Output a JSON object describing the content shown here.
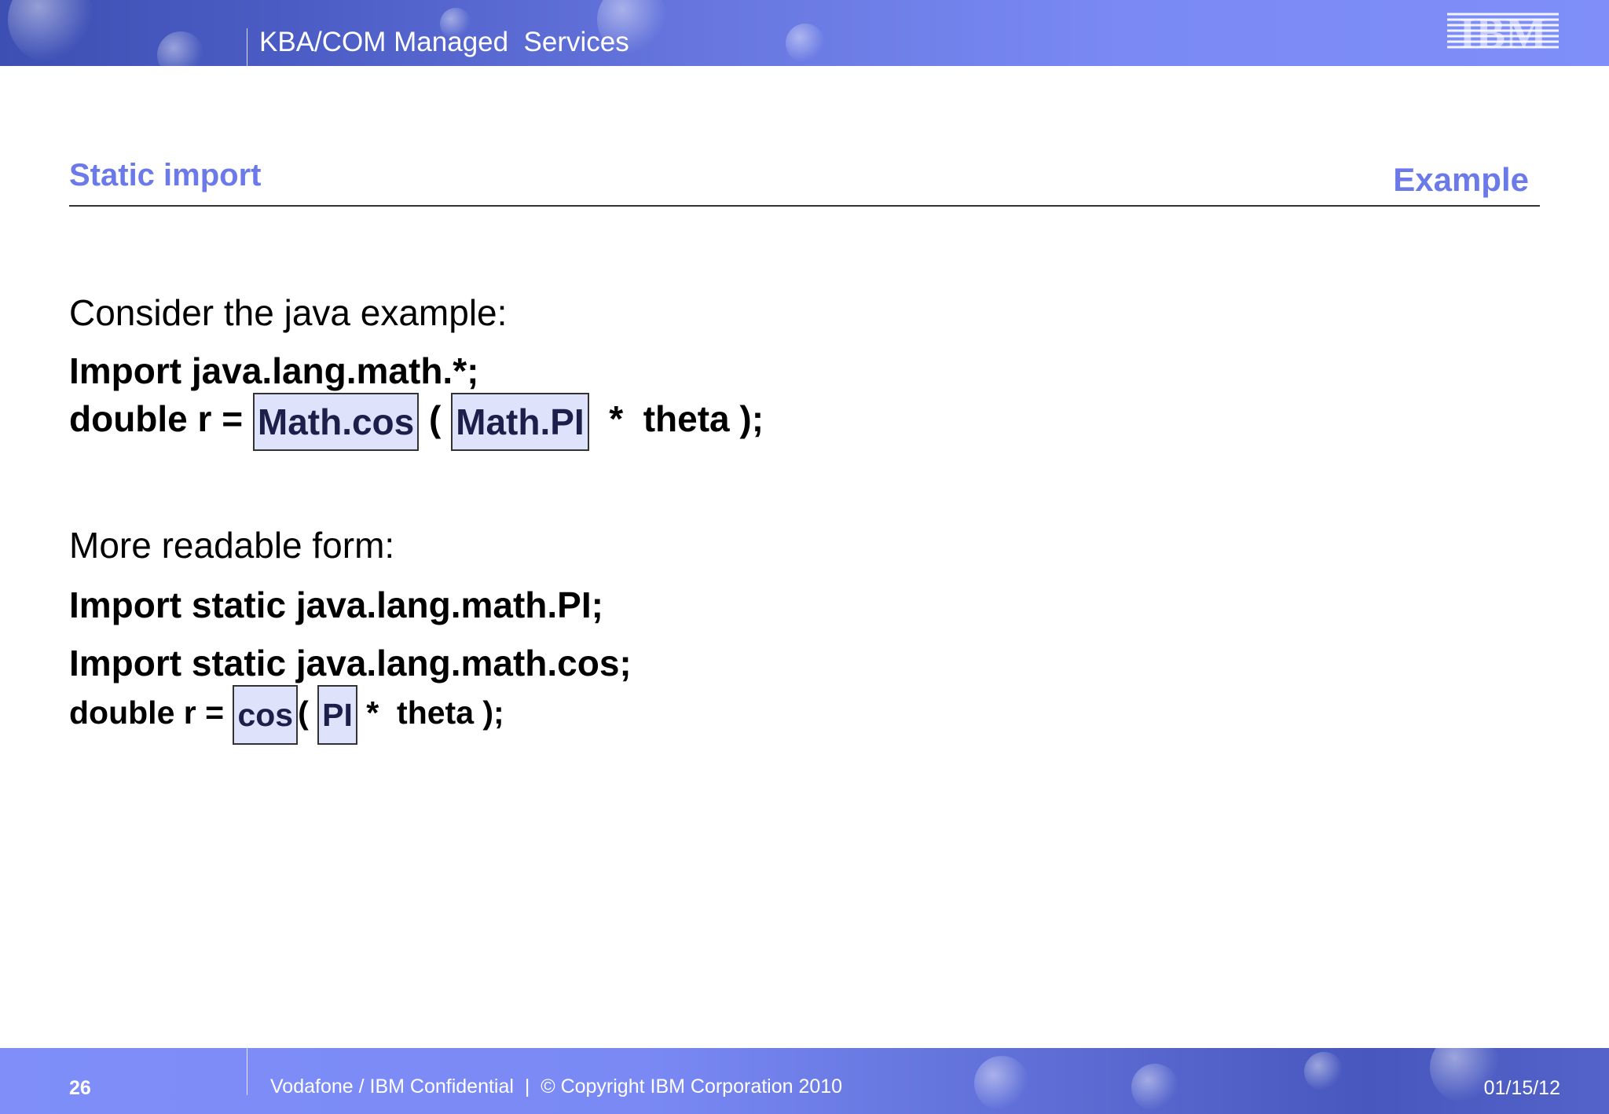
{
  "header": {
    "title": "KBA/COM Managed  Services",
    "logo": "IBM"
  },
  "section": {
    "title": "Static import",
    "tag": "Example"
  },
  "body": {
    "line1": "Consider the java example:",
    "line2": "Import java.lang.math.*;",
    "line3": {
      "prefix": "double r = ",
      "hl1": "Math.cos",
      "mid": " ( ",
      "hl2": "Math.PI",
      "suffix": "  *  theta );"
    },
    "line4": "More readable form:",
    "line5": "Import static java.lang.math.PI;",
    "line6": "Import static java.lang.math.cos;",
    "line7": {
      "prefix": "double r = ",
      "hl1": "cos",
      "mid": "( ",
      "hl2": "PI",
      "suffix": " *  theta );"
    }
  },
  "footer": {
    "page_number": "26",
    "confidential": "Vodafone / IBM Confidential  |  © Copyright IBM Corporation 2010",
    "date": "01/15/12"
  },
  "colors": {
    "header_band": "#7a89f4",
    "accent_title": "#6b7ae8",
    "highlight_fill": "#dfe2fb"
  }
}
